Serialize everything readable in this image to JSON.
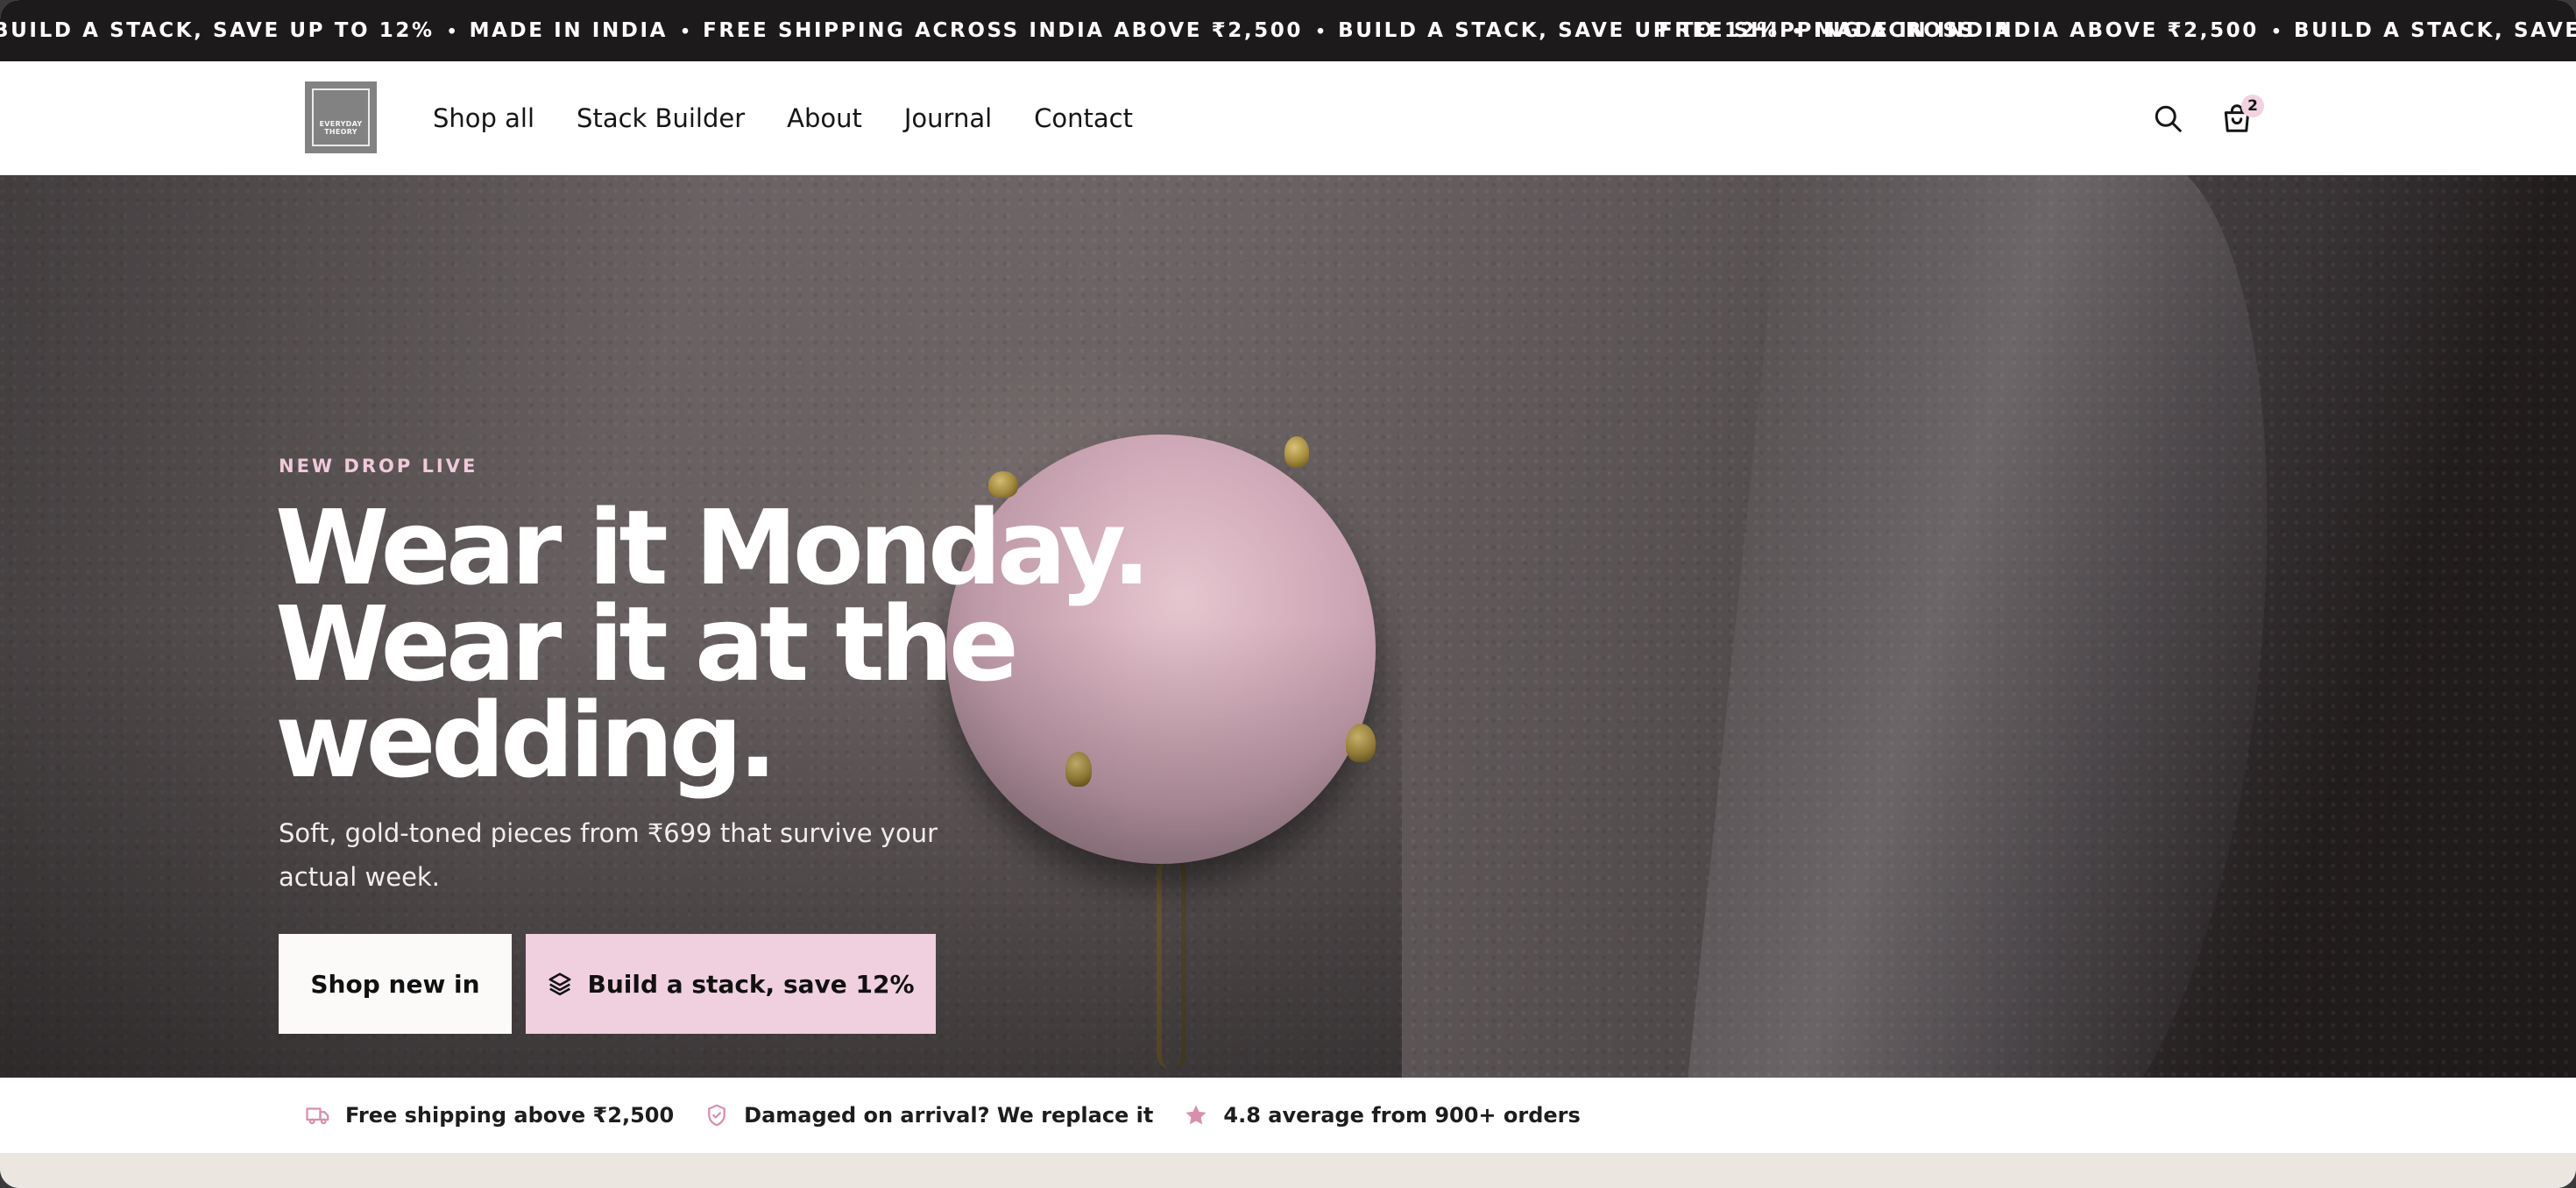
{
  "announcement": {
    "messages": [
      "Build a stack, save up to 12%",
      "Made in India",
      "Free shipping across India above ₹2,500",
      "Build a stack, save up to 12%",
      "Made in India"
    ],
    "messages_repeat": [
      "Free shipping across India above ₹2,500",
      "Build a stack, save up to 12%"
    ],
    "separator": "•"
  },
  "header": {
    "logo_text_line1": "EVERYDAY",
    "logo_text_line2": "THEORY",
    "nav": [
      "Shop all",
      "Stack Builder",
      "About",
      "Journal",
      "Contact"
    ],
    "cart_count": "2",
    "search_icon": "search-icon",
    "cart_icon": "shopping-bag-icon"
  },
  "hero": {
    "eyebrow": "New drop live",
    "headline_line1": "Wear it Monday.",
    "headline_line2": "Wear it at the",
    "headline_line3": "wedding.",
    "subcopy": "Soft, gold-toned pieces from ₹699 that survive your actual week.",
    "primary_cta": "Shop new in",
    "secondary_cta": "Build a stack, save 12%",
    "secondary_cta_icon": "layers-icon"
  },
  "trust": {
    "items": [
      {
        "icon": "truck-icon",
        "text": "Free shipping above ₹2,500"
      },
      {
        "icon": "shield-icon",
        "text": "Damaged on arrival? We replace it"
      },
      {
        "icon": "star-icon",
        "text": "4.8 average from 900+ orders"
      }
    ]
  },
  "colors": {
    "announcement_bg": "#1c1a1b",
    "accent_pink": "#f0cfdf",
    "eyebrow_pink": "#f0c9da",
    "trust_icon_pink": "#d88fae"
  }
}
